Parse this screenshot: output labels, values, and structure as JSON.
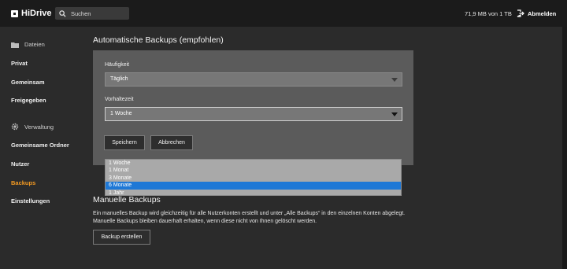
{
  "topbar": {
    "brand": "HiDrive",
    "search_placeholder": "Suchen",
    "quota": "71,9 MB von 1 TB",
    "logout_label": "Abmelden"
  },
  "sidebar": {
    "files_header": "Dateien",
    "files_items": [
      "Privat",
      "Gemeinsam",
      "Freigegeben"
    ],
    "admin_header": "Verwaltung",
    "admin_items": [
      "Gemeinsame Ordner",
      "Nutzer",
      "Backups",
      "Einstellungen"
    ],
    "active_item": "Backups"
  },
  "auto": {
    "title": "Automatische Backups (empfohlen)",
    "frequency_label": "Häufigkeit",
    "frequency_value": "Täglich",
    "retention_label": "Vorhaltezeit",
    "retention_value": "1 Woche",
    "save_label": "Speichern",
    "cancel_label": "Abbrechen",
    "retention_options": [
      "1 Woche",
      "1 Monat",
      "3 Monate",
      "6 Monate",
      "1 Jahr"
    ],
    "highlighted_option": "6 Monate"
  },
  "manual": {
    "title": "Manuelle Backups",
    "line1": "Ein manuelles Backup wird gleichzeitig für alle Nutzerkonten erstellt und unter „Alle Backups“ in den einzelnen Konten abgelegt.",
    "line2": "Manuelle Backups bleiben dauerhaft erhalten, wenn diese nicht von Ihnen gelöscht werden.",
    "create_label": "Backup erstellen"
  },
  "colors": {
    "accent": "#f39a22",
    "highlight": "#1e78d6"
  }
}
